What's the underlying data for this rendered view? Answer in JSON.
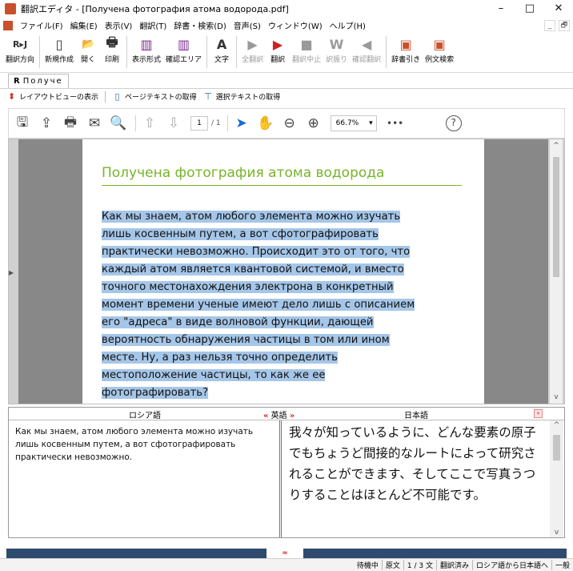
{
  "window": {
    "title": "翻訳エディタ - [Получена фотография атома водорода.pdf]",
    "buttons": [
      "–",
      "□",
      "✕"
    ]
  },
  "menubar": {
    "items": [
      "ファイル(F)",
      "編集(E)",
      "表示(V)",
      "翻訳(T)",
      "辞書・検索(D)",
      "音声(S)",
      "ウィンドウ(W)",
      "ヘルプ(H)"
    ],
    "right_controls": [
      "_",
      "🗗"
    ]
  },
  "toolbar": {
    "buttons": [
      {
        "label": "翻訳方向",
        "icon": "R▸J",
        "enabled": true
      },
      {
        "label": "新規作成",
        "icon": "▯",
        "enabled": true
      },
      {
        "label": "開く",
        "icon": "📂",
        "enabled": true
      },
      {
        "label": "印刷",
        "icon": "🖶",
        "enabled": true
      },
      {
        "label": "表示形式",
        "icon": "▥",
        "enabled": true
      },
      {
        "label": "確認エリア",
        "icon": "▥",
        "enabled": true
      },
      {
        "label": "文字",
        "icon": "A",
        "enabled": true
      },
      {
        "label": "全翻訳",
        "icon": "▶",
        "enabled": false
      },
      {
        "label": "翻訳",
        "icon": "▶",
        "enabled": true
      },
      {
        "label": "翻訳中止",
        "icon": "■",
        "enabled": false
      },
      {
        "label": "訳振り",
        "icon": "W",
        "enabled": false
      },
      {
        "label": "確認翻訳",
        "icon": "◀",
        "enabled": false
      },
      {
        "label": "辞書引き",
        "icon": "▣",
        "enabled": true
      },
      {
        "label": "例文検索",
        "icon": "▣",
        "enabled": true
      }
    ]
  },
  "doc_tab": {
    "prefix": "R",
    "label": "Получе"
  },
  "layout_bar": {
    "buttons": [
      {
        "label": "レイアウトビューの表示",
        "icon": "⬍"
      },
      {
        "label": "ページテキストの取得",
        "icon": "▯"
      },
      {
        "label": "選択テキストの取得",
        "icon": "⊤"
      }
    ]
  },
  "pdf_toolbar": {
    "page_current": "1",
    "page_total": "/ 1",
    "zoom": "66.7%",
    "more": "•••",
    "help": "?"
  },
  "pdf_page": {
    "title": "Получена фотография атома водорода",
    "lines": [
      "Как мы знаем, атом любого элемента можно изучать",
      "лишь косвенным путем, а вот сфотографировать",
      "практически невозможно. Происходит это от того, что",
      "каждый атом является квантовой системой, и вместо",
      "точного местонахождения электрона в конкретный",
      "момент времени ученые имеют дело лишь с описанием",
      "его \"адреса\" в виде волновой функции, дающей",
      "вероятность обнаружения частицы в том или ином",
      "месте. Ну, а раз нельзя точно определить",
      "местоположение частицы, то как же ее",
      "фотографировать?"
    ]
  },
  "translation": {
    "source_lang": "ロシア語",
    "middle_left_arrow": "«",
    "middle_lang": "英語",
    "middle_right_arrow": "»",
    "target_lang": "日本語",
    "close": "«",
    "source_text": "Как мы знаем, атом любого элемента можно изучать лишь косвенным путем, а вот сфотографировать практически невозможно.",
    "target_text": "我々が知っているように、どんな要素の原子でもちょうど間接的なルートによって研究されることができます、そしてここで写真うつりすることはほとんど不可能です。"
  },
  "splitter": {
    "toggle": "≈"
  },
  "statusbar": {
    "items": [
      "待機中",
      "原文",
      "1 / 3 文",
      "翻訳済み",
      "ロシア語から日本語へ",
      "一般"
    ]
  }
}
